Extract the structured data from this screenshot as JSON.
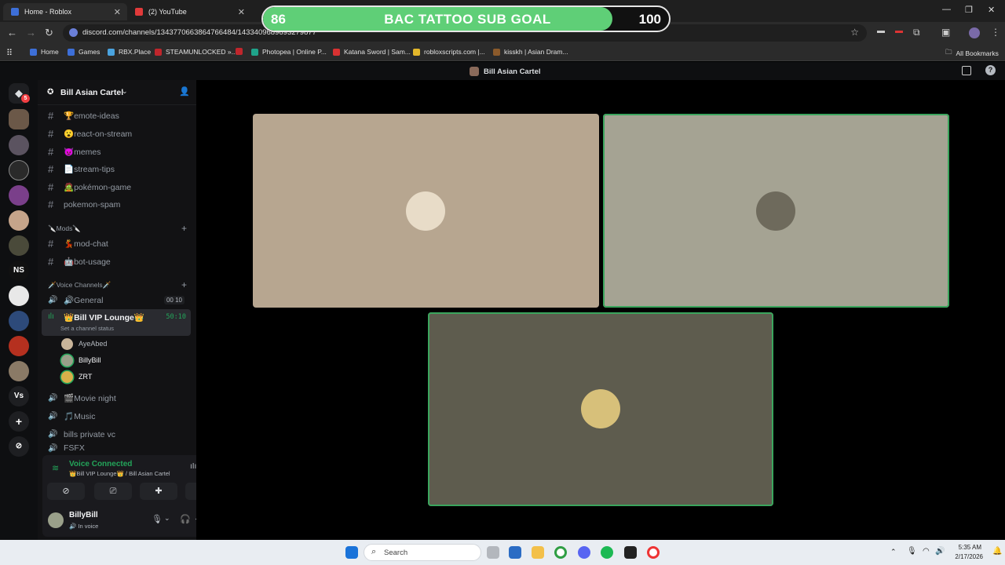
{
  "browser": {
    "tabs": [
      {
        "label": "Home - Roblox",
        "color": "#3d6fd8"
      },
      {
        "label": "(2) YouTube",
        "color": "#e03a3a"
      }
    ],
    "url": "discord.com/channels/1343770663864766484/1433409689693279877",
    "bookmarks": [
      {
        "label": "Home",
        "color": "#3d6fd8"
      },
      {
        "label": "Games",
        "color": "#3d6fd8"
      },
      {
        "label": "RBX.Place",
        "color": "#4aa3df"
      },
      {
        "label": "STEAMUNLOCKED »...",
        "color": "#c0262c"
      },
      {
        "label": "",
        "color": "#c0262c"
      },
      {
        "label": "Photopea | Online P...",
        "color": "#1fa38a"
      },
      {
        "label": "Katana Sword | Sam...",
        "color": "#d93232"
      },
      {
        "label": "robloxscripts.com |...",
        "color": "#e3b72b"
      },
      {
        "label": "kisskh | Asian Dram...",
        "color": "#8b5a2b"
      }
    ],
    "all_bookmarks": "All Bookmarks"
  },
  "goal": {
    "start": "86",
    "title": "BAC TATTOO SUB GOAL",
    "end": "100",
    "progress": 0.86
  },
  "discord": {
    "window_title": "Bill Asian Cartel",
    "server_name": "Bill Asian Cartel",
    "rail_badge": "5",
    "rail_text_server": "Vs",
    "rail_ns": "NS",
    "text_channels": [
      {
        "label": "🏆emote-ideas"
      },
      {
        "label": "😮react-on-stream"
      },
      {
        "label": "😈memes"
      },
      {
        "label": "📄stream-tips"
      },
      {
        "label": "🧟pokémon-game"
      },
      {
        "label": "pokemon-spam"
      }
    ],
    "mods_category": "🔪Mods🔪",
    "mod_channels": [
      {
        "label": "💃mod-chat"
      },
      {
        "label": "🤖bot-usage"
      }
    ],
    "voice_category": "🗡️Voice Channels🗡️",
    "general": {
      "label": "🔊General",
      "c1": "00",
      "c2": "10"
    },
    "vip": {
      "label": "👑Bill VIP Lounge👑",
      "timer": "50:10",
      "status": "Set a channel status"
    },
    "voice_users": [
      {
        "name": "AyeAbed",
        "color": "#c9b59a"
      },
      {
        "name": "BillyBill",
        "color": "#9aa08a"
      },
      {
        "name": "ZRT",
        "color": "#d8b04a"
      }
    ],
    "other_voice": [
      {
        "label": "🎬Movie night"
      },
      {
        "label": "🎵Music"
      },
      {
        "label": "bills private vc"
      },
      {
        "label": "FSFX"
      }
    ],
    "voice_connected": "Voice Connected",
    "voice_location": "👑Bill VIP Lounge👑 / Bill Asian Cartel",
    "user": {
      "name": "BillyBill",
      "status": "In voice"
    }
  },
  "stage": {
    "tiles": [
      {
        "bg": "#b7a690",
        "speaking": false
      },
      {
        "bg": "#a5a393",
        "speaking": true
      },
      {
        "bg": "#5e5c4e",
        "speaking": true
      }
    ]
  },
  "taskbar": {
    "search": "Search",
    "time": "5:35 AM",
    "date": "2/17/2026"
  }
}
